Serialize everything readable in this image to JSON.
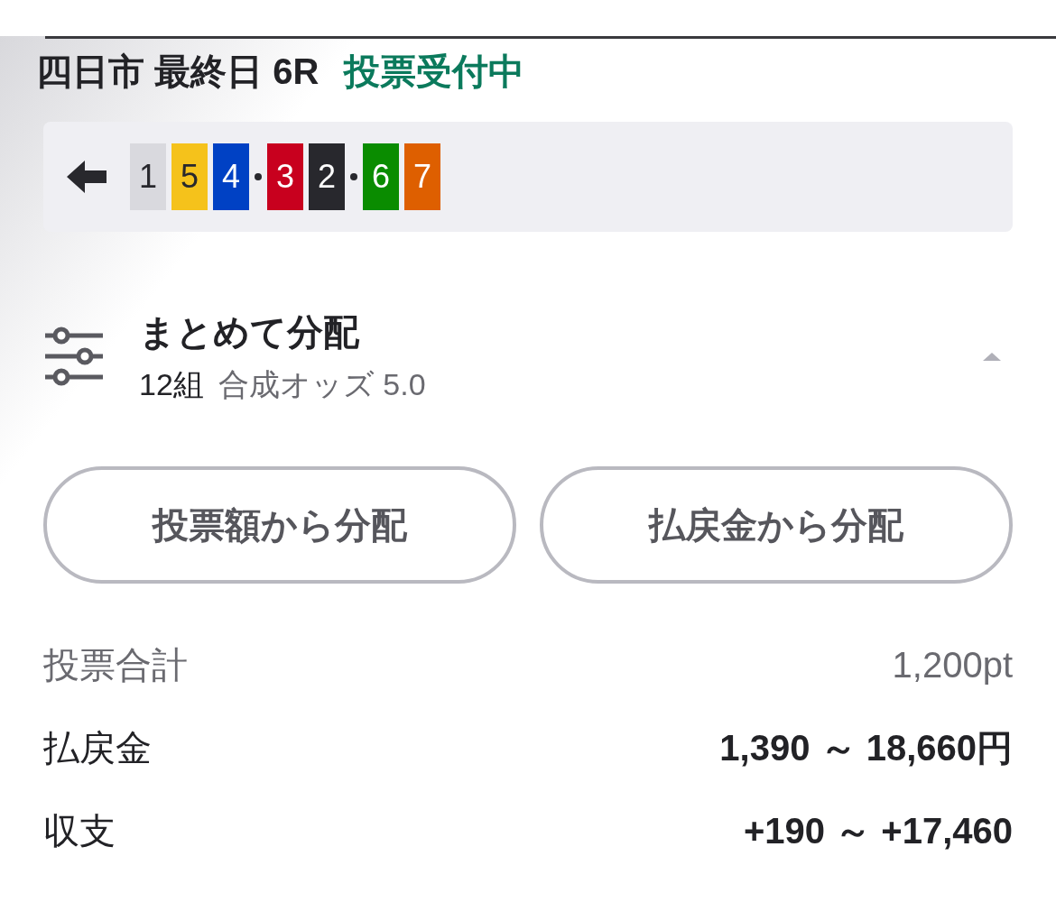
{
  "race": {
    "title": "四日市 最終日 6R",
    "status": "投票受付中"
  },
  "combination": {
    "groups": [
      [
        {
          "label": "1",
          "color": "#d9d9de"
        },
        {
          "label": "5",
          "color": "#f5c21b"
        },
        {
          "label": "4",
          "color": "#0041c4"
        }
      ],
      [
        {
          "label": "3",
          "color": "#c8001e"
        },
        {
          "label": "2",
          "color": "#28282d"
        }
      ],
      [
        {
          "label": "6",
          "color": "#0a8c00"
        },
        {
          "label": "7",
          "color": "#de5f00"
        }
      ]
    ]
  },
  "distribution": {
    "title": "まとめて分配",
    "count": "12組",
    "odds": "合成オッズ 5.0",
    "expanded": true
  },
  "buttons": [
    "投票額から分配",
    "払戻金から分配"
  ],
  "summary": [
    {
      "label": "投票合計",
      "value": "1,200pt",
      "kind": "plain"
    },
    {
      "label": "払戻金",
      "value": "1,390 ～ 18,660円",
      "kind": "bold"
    },
    {
      "label": "収支",
      "value": "+190 ～ +17,460",
      "kind": "bold"
    }
  ]
}
